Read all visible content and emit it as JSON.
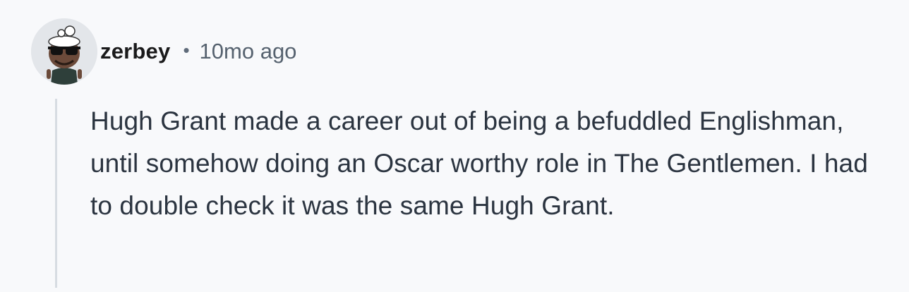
{
  "comment": {
    "author": {
      "username": "zerbey",
      "avatar_icon": "user-avatar-icon"
    },
    "separator": "•",
    "timestamp": "10mo ago",
    "body": "Hugh Grant made a career out of being a befuddled Englishman, until somehow doing an Oscar worthy role in The Gentlemen. I had to double check it was the same Hugh Grant."
  },
  "colors": {
    "background": "#f8f9fb",
    "username": "#1a1a1b",
    "timestamp": "#56626f",
    "body_text": "#2b3440",
    "thread_line": "#d7dce2"
  }
}
